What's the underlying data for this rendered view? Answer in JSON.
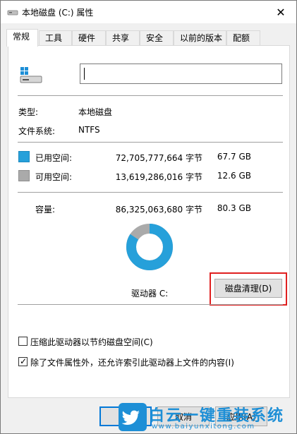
{
  "window": {
    "title": "本地磁盘 (C:) 属性",
    "close_glyph": "✕"
  },
  "tabs": [
    {
      "label": "常规",
      "active": true
    },
    {
      "label": "工具"
    },
    {
      "label": "硬件"
    },
    {
      "label": "共享"
    },
    {
      "label": "安全"
    },
    {
      "label": "以前的版本"
    },
    {
      "label": "配额"
    }
  ],
  "general": {
    "drive_name_value": "",
    "type_label": "类型:",
    "type_value": "本地磁盘",
    "fs_label": "文件系统:",
    "fs_value": "NTFS",
    "used": {
      "label": "已用空间:",
      "bytes": "72,705,777,664 字节",
      "size": "67.7 GB"
    },
    "free": {
      "label": "可用空间:",
      "bytes": "13,619,286,016 字节",
      "size": "12.6 GB"
    },
    "capacity": {
      "label": "容量:",
      "bytes": "86,325,063,680 字节",
      "size": "80.3 GB"
    },
    "used_fraction": 0.842,
    "drive_label": "驱动器 C:",
    "cleanup_button": "磁盘清理(D)",
    "compress_label": "压缩此驱动器以节约磁盘空间(C)",
    "compress_checked": false,
    "index_label": "除了文件属性外，还允许索引此驱动器上文件的内容(I)",
    "index_checked": true,
    "check_glyph": "✓"
  },
  "buttons": {
    "cancel": "取消",
    "apply": "应用(A)"
  },
  "colors": {
    "used": "#26a0da",
    "free": "#aaaaaa",
    "highlight": "#e02020"
  },
  "watermark": {
    "title": "白云一键重装系统",
    "url": "www.baiyunxitong.com"
  }
}
